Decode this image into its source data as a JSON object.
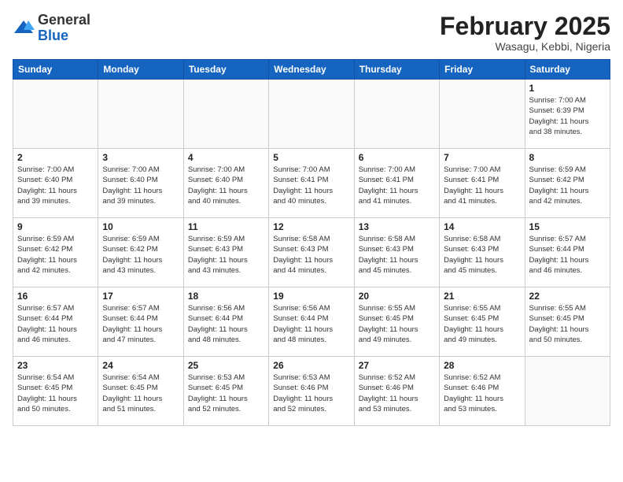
{
  "logo": {
    "general": "General",
    "blue": "Blue"
  },
  "header": {
    "month": "February 2025",
    "location": "Wasagu, Kebbi, Nigeria"
  },
  "weekdays": [
    "Sunday",
    "Monday",
    "Tuesday",
    "Wednesday",
    "Thursday",
    "Friday",
    "Saturday"
  ],
  "weeks": [
    [
      {
        "day": "",
        "info": ""
      },
      {
        "day": "",
        "info": ""
      },
      {
        "day": "",
        "info": ""
      },
      {
        "day": "",
        "info": ""
      },
      {
        "day": "",
        "info": ""
      },
      {
        "day": "",
        "info": ""
      },
      {
        "day": "1",
        "info": "Sunrise: 7:00 AM\nSunset: 6:39 PM\nDaylight: 11 hours\nand 38 minutes."
      }
    ],
    [
      {
        "day": "2",
        "info": "Sunrise: 7:00 AM\nSunset: 6:40 PM\nDaylight: 11 hours\nand 39 minutes."
      },
      {
        "day": "3",
        "info": "Sunrise: 7:00 AM\nSunset: 6:40 PM\nDaylight: 11 hours\nand 39 minutes."
      },
      {
        "day": "4",
        "info": "Sunrise: 7:00 AM\nSunset: 6:40 PM\nDaylight: 11 hours\nand 40 minutes."
      },
      {
        "day": "5",
        "info": "Sunrise: 7:00 AM\nSunset: 6:41 PM\nDaylight: 11 hours\nand 40 minutes."
      },
      {
        "day": "6",
        "info": "Sunrise: 7:00 AM\nSunset: 6:41 PM\nDaylight: 11 hours\nand 41 minutes."
      },
      {
        "day": "7",
        "info": "Sunrise: 7:00 AM\nSunset: 6:41 PM\nDaylight: 11 hours\nand 41 minutes."
      },
      {
        "day": "8",
        "info": "Sunrise: 6:59 AM\nSunset: 6:42 PM\nDaylight: 11 hours\nand 42 minutes."
      }
    ],
    [
      {
        "day": "9",
        "info": "Sunrise: 6:59 AM\nSunset: 6:42 PM\nDaylight: 11 hours\nand 42 minutes."
      },
      {
        "day": "10",
        "info": "Sunrise: 6:59 AM\nSunset: 6:42 PM\nDaylight: 11 hours\nand 43 minutes."
      },
      {
        "day": "11",
        "info": "Sunrise: 6:59 AM\nSunset: 6:43 PM\nDaylight: 11 hours\nand 43 minutes."
      },
      {
        "day": "12",
        "info": "Sunrise: 6:58 AM\nSunset: 6:43 PM\nDaylight: 11 hours\nand 44 minutes."
      },
      {
        "day": "13",
        "info": "Sunrise: 6:58 AM\nSunset: 6:43 PM\nDaylight: 11 hours\nand 45 minutes."
      },
      {
        "day": "14",
        "info": "Sunrise: 6:58 AM\nSunset: 6:43 PM\nDaylight: 11 hours\nand 45 minutes."
      },
      {
        "day": "15",
        "info": "Sunrise: 6:57 AM\nSunset: 6:44 PM\nDaylight: 11 hours\nand 46 minutes."
      }
    ],
    [
      {
        "day": "16",
        "info": "Sunrise: 6:57 AM\nSunset: 6:44 PM\nDaylight: 11 hours\nand 46 minutes."
      },
      {
        "day": "17",
        "info": "Sunrise: 6:57 AM\nSunset: 6:44 PM\nDaylight: 11 hours\nand 47 minutes."
      },
      {
        "day": "18",
        "info": "Sunrise: 6:56 AM\nSunset: 6:44 PM\nDaylight: 11 hours\nand 48 minutes."
      },
      {
        "day": "19",
        "info": "Sunrise: 6:56 AM\nSunset: 6:44 PM\nDaylight: 11 hours\nand 48 minutes."
      },
      {
        "day": "20",
        "info": "Sunrise: 6:55 AM\nSunset: 6:45 PM\nDaylight: 11 hours\nand 49 minutes."
      },
      {
        "day": "21",
        "info": "Sunrise: 6:55 AM\nSunset: 6:45 PM\nDaylight: 11 hours\nand 49 minutes."
      },
      {
        "day": "22",
        "info": "Sunrise: 6:55 AM\nSunset: 6:45 PM\nDaylight: 11 hours\nand 50 minutes."
      }
    ],
    [
      {
        "day": "23",
        "info": "Sunrise: 6:54 AM\nSunset: 6:45 PM\nDaylight: 11 hours\nand 50 minutes."
      },
      {
        "day": "24",
        "info": "Sunrise: 6:54 AM\nSunset: 6:45 PM\nDaylight: 11 hours\nand 51 minutes."
      },
      {
        "day": "25",
        "info": "Sunrise: 6:53 AM\nSunset: 6:45 PM\nDaylight: 11 hours\nand 52 minutes."
      },
      {
        "day": "26",
        "info": "Sunrise: 6:53 AM\nSunset: 6:46 PM\nDaylight: 11 hours\nand 52 minutes."
      },
      {
        "day": "27",
        "info": "Sunrise: 6:52 AM\nSunset: 6:46 PM\nDaylight: 11 hours\nand 53 minutes."
      },
      {
        "day": "28",
        "info": "Sunrise: 6:52 AM\nSunset: 6:46 PM\nDaylight: 11 hours\nand 53 minutes."
      },
      {
        "day": "",
        "info": ""
      }
    ]
  ]
}
